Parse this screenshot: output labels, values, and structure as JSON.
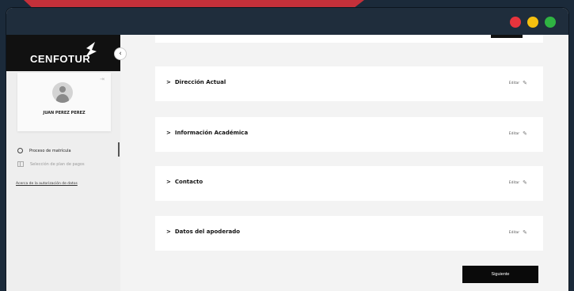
{
  "window": {
    "controls": [
      "close",
      "minimize",
      "maximize"
    ]
  },
  "brand": {
    "name": "CENFOTUR",
    "logo_icon": "cenfotur-logo"
  },
  "sidebar": {
    "collapse_icon": "chevron-left-icon",
    "user": {
      "name": "JUAN PEREZ PEREZ",
      "avatar_icon": "user-avatar-icon",
      "logout_icon": "logout-icon"
    },
    "items": [
      {
        "label": "Proceso de matrícula",
        "icon": "circle-icon"
      },
      {
        "label": "Selección de plan de pagos",
        "icon": "table-icon"
      }
    ],
    "privacy_link": "Acerca de la autorización de datos"
  },
  "main": {
    "sections": [
      {
        "title": "Dirección Actual",
        "edit_label": "Editar"
      },
      {
        "title": "Información Académica",
        "edit_label": "Editar"
      },
      {
        "title": "Contacto",
        "edit_label": "Editar"
      },
      {
        "title": "Datos del apoderado",
        "edit_label": "Editar"
      }
    ],
    "next_label": "Siguiente"
  },
  "colors": {
    "accent": "#c4303a",
    "dark": "#111111",
    "titlebar": "#1f2d3c"
  }
}
